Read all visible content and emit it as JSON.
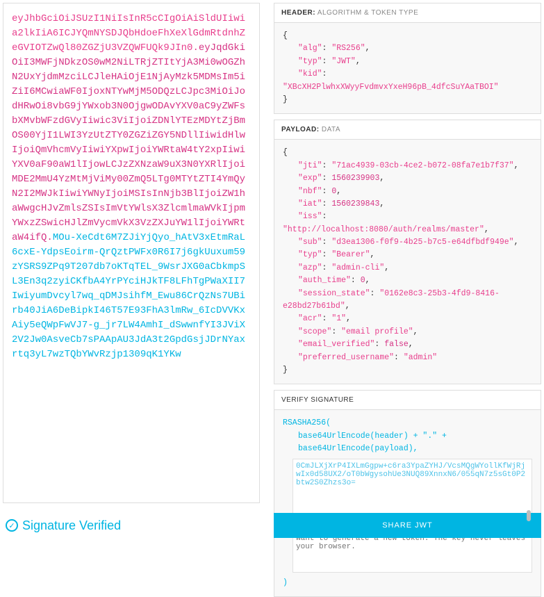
{
  "token": {
    "header_part": "eyJhbGciOiJSUzI1NiIsInR5cCIgOiAiSldUIiwia2lkIiA6ICJYQmNYSDJQbHdoeFhXeXlGdmRtdnhZeGVIOTZwQl80ZGZjU3VZQWFUQk9JIn0",
    "payload_part": "eyJqdGkiOiI3MWFjNDkzOS0wM2NiLTRjZTItYjA3Mi0wOGZhN2UxYjdmMzciLCJleHAiOjE1NjAyMzk5MDMsIm5iZiI6MCwiaWF0IjoxNTYwMjM5ODQzLCJpc3MiOiJodHRwOi8vbG9jYWxob3N0OjgwODAvYXV0aC9yZWFsbXMvbWFzdGVyIiwic3ViIjoiZDNlYTEzMDYtZjBmOS00YjI1LWI3YzUtZTY0ZGZiZGY5NDllIiwidHlwIjoiQmVhcmVyIiwiYXpwIjoiYWRtaW4tY2xpIiwiYXV0aF90aW1lIjowLCJzZXNzaW9uX3N0YXRlIjoiMDE2MmU4YzMtMjViMy00ZmQ5LTg0MTYtZTI4YmQyN2I2MWJkIiwiYWNyIjoiMSIsInNjb3BlIjoiZW1haWwgcHJvZmlsZSIsImVtYWlsX3ZlcmlmaWVkIjpmYWxzZSwicHJlZmVycmVkX3VzZXJuYW1lIjoiYWRtaW4ifQ",
    "sig_part": "MOu-XeCdt6M7ZJiYjQyo_hAtV3xEtmRaL6cxE-YdpsEoirm-QrQztPWFx0R6I7j6gkUuxum59zYSRS9ZPq9T207db7oKTqTEL_9WsrJXG0aCbkmpSL3En3q2zyiCKfbA4YrPYciHJkTF8LFhTgPWaXII7IwiyumDvcyl7wq_qDMJsihfM_Ewu86CrQzNs7UBirb40JiA6DeBipkI46T57E93FhA3lmRw_6IcDVVKxAiy5eQWpFwVJ7-g_jr7LW4AmhI_dSwwnfYI3JViX2V2Jw0AsveCb7sPAApAU3JdA3t2GpdGsjJDrNYaxrtq3yL7wzTQbYWvRzjp1309qK1YKw"
  },
  "sections": {
    "header_label": "HEADER:",
    "header_sub": "ALGORITHM & TOKEN TYPE",
    "payload_label": "PAYLOAD:",
    "payload_sub": "DATA",
    "verify_label": "VERIFY SIGNATURE"
  },
  "header_json": {
    "alg": "RS256",
    "typ": "JWT",
    "kid": "XBcXH2PlwhxXWyyFvdmvxYxeH96pB_4dfcSuYAaTBOI"
  },
  "payload_json": {
    "jti": "71ac4939-03cb-4ce2-b072-08fa7e1b7f37",
    "exp": 1560239903,
    "nbf": 0,
    "iat": 1560239843,
    "iss": "http://localhost:8080/auth/realms/master",
    "sub": "d3ea1306-f0f9-4b25-b7c5-e64dfbdf949e",
    "typ": "Bearer",
    "azp": "admin-cli",
    "auth_time": 0,
    "session_state": "0162e8c3-25b3-4fd9-8416-e28bd27b61bd",
    "acr": "1",
    "scope": "email profile",
    "email_verified": false,
    "preferred_username": "admin"
  },
  "verify": {
    "algo_open": "RSASHA256(",
    "l1": "base64UrlEncode(header) + \".\" +",
    "l2": "base64UrlEncode(payload),",
    "pubkey_snippet": "0CmJLXjXrP4IXLmGgpw+c6ra3YpaZYHJ/VcsMQgWYollKfWjRjwIx0d58UX2/oT0bWgysohUe3NUQ89XnnxN6/055qN7z5sGt0P2btw2S0Zhzs3o=",
    "privkey_placeholder": "Private Key. Enter it in plain text only if you want to generate a new token. The key never leaves your browser.",
    "close": ")"
  },
  "status": {
    "text": "Signature Verified"
  },
  "share": {
    "label": "SHARE JWT"
  }
}
